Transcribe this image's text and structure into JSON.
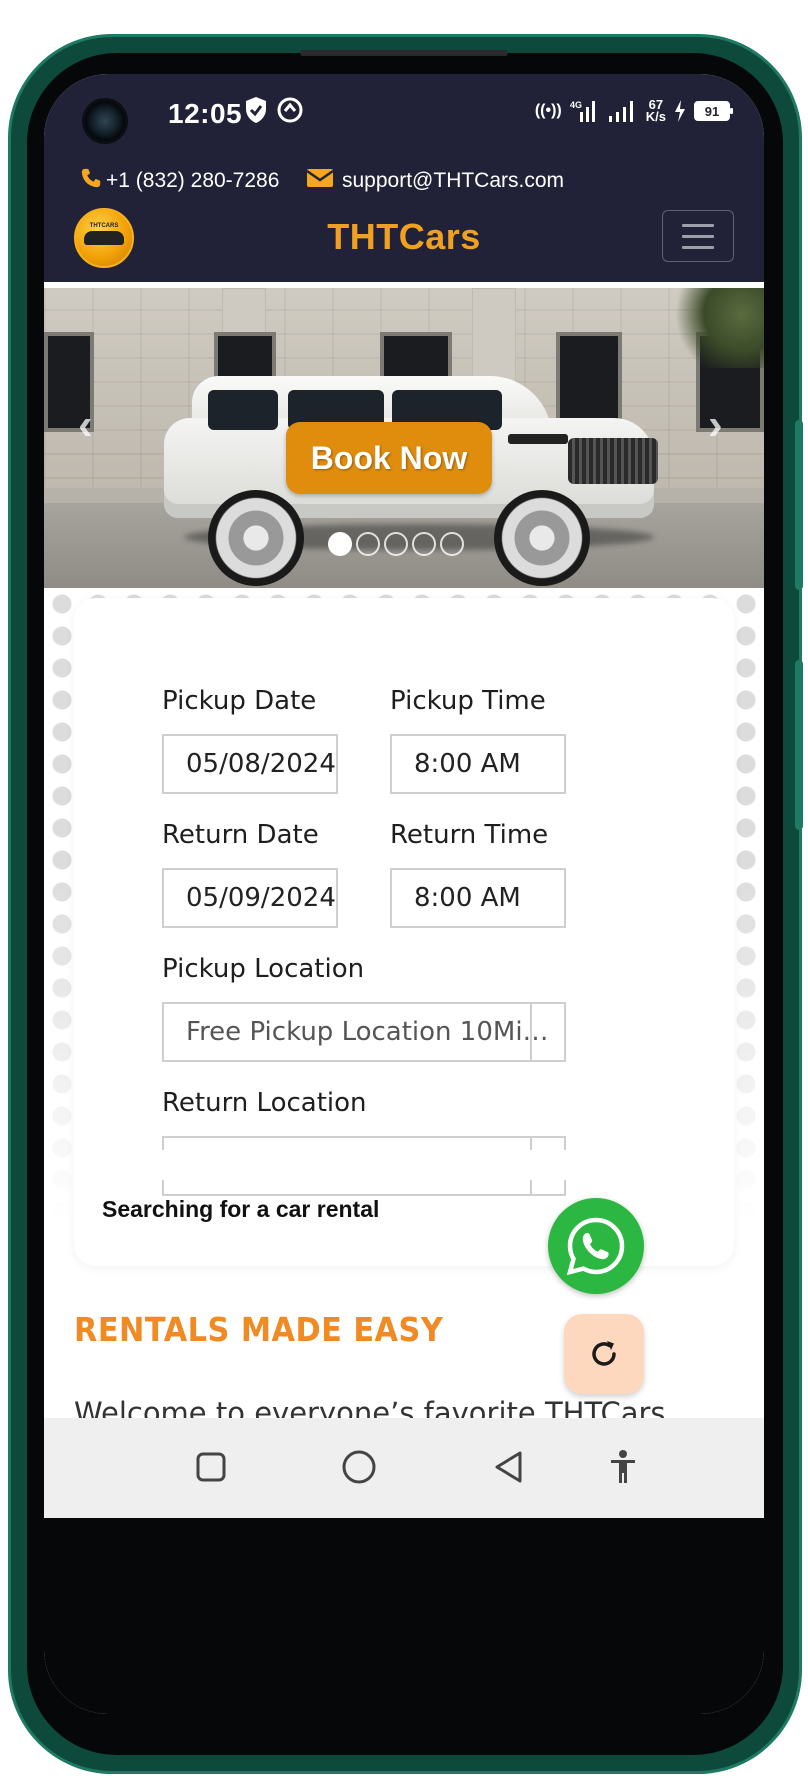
{
  "status_bar": {
    "time": "12:05",
    "network_label": "4G",
    "speed_value": "67",
    "speed_unit": "K/s",
    "battery": "91"
  },
  "header": {
    "phone": "+1 (832) 280-7286",
    "email": "support@THTCars.com",
    "brand": "THTCars",
    "logo_text": "THTCARS"
  },
  "hero": {
    "book_now_label": "Book Now",
    "prev_arrow": "‹",
    "next_arrow": "›",
    "slide_count": 5,
    "active_slide": 1
  },
  "search": {
    "pickup_date_label": "Pickup Date",
    "pickup_date_value": "05/08/2024",
    "pickup_time_label": "Pickup Time",
    "pickup_time_value": "8:00 AM",
    "return_date_label": "Return Date",
    "return_date_value": "05/09/2024",
    "return_time_label": "Return Time",
    "return_time_value": "8:00 AM",
    "pickup_location_label": "Pickup Location",
    "pickup_location_value": "Free Pickup Location 10Mi…",
    "return_location_label": "Return Location",
    "status_text": "Searching for a car rental"
  },
  "content": {
    "heading": "RENTALS MADE EASY",
    "welcome": "Welcome to everyone’s favorite THTCars."
  },
  "colors": {
    "header_bg": "#212237",
    "brand_orange": "#f0a020",
    "book_now_bg": "#e08d0e",
    "heading_orange": "#f08a24",
    "whatsapp_green": "#2bb741",
    "refresh_bg": "#fdd8be"
  },
  "icons": {
    "phone": "phone-icon",
    "email": "envelope-icon",
    "menu": "hamburger-icon",
    "whatsapp": "whatsapp-icon",
    "refresh": "refresh-icon",
    "nav_recents": "square-icon",
    "nav_home": "circle-icon",
    "nav_back": "triangle-back-icon",
    "nav_accessibility": "accessibility-icon"
  }
}
